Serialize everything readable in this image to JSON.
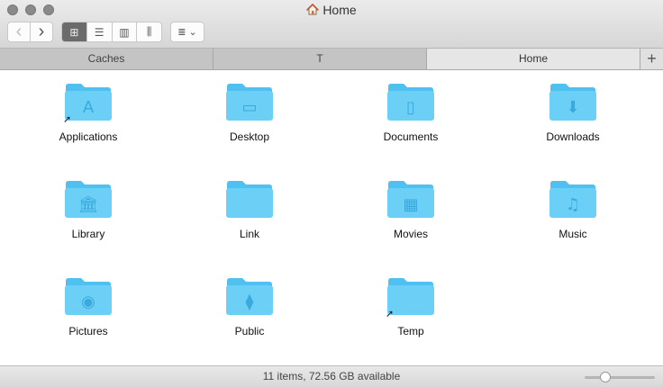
{
  "window": {
    "title": "Home"
  },
  "toolbar": {
    "back": "‹",
    "forward": "›",
    "view_modes": [
      "icon",
      "list",
      "column",
      "cover-flow"
    ],
    "active_view": "icon"
  },
  "tabs": [
    {
      "label": "Caches"
    },
    {
      "label": "T"
    },
    {
      "label": "Home",
      "active": true
    }
  ],
  "tab_add": "+",
  "items": [
    {
      "name": "Applications",
      "glyph": "A",
      "alias": true
    },
    {
      "name": "Desktop",
      "glyph": "▭",
      "alias": false
    },
    {
      "name": "Documents",
      "glyph": "▯",
      "alias": false
    },
    {
      "name": "Downloads",
      "glyph": "⬇",
      "alias": false
    },
    {
      "name": "Library",
      "glyph": "🏛",
      "alias": false
    },
    {
      "name": "Link",
      "glyph": "",
      "alias": false
    },
    {
      "name": "Movies",
      "glyph": "▦",
      "alias": false
    },
    {
      "name": "Music",
      "glyph": "♫",
      "alias": false
    },
    {
      "name": "Pictures",
      "glyph": "◉",
      "alias": false
    },
    {
      "name": "Public",
      "glyph": "⧫",
      "alias": false
    },
    {
      "name": "Temp",
      "glyph": "",
      "alias": true
    }
  ],
  "status": {
    "text": "11 items, 72.56 GB available",
    "icon_size": 0.25
  },
  "colors": {
    "folder": "#6ccff6",
    "folder_tab": "#4fc0ef",
    "glyph": "#3aa9dc"
  }
}
